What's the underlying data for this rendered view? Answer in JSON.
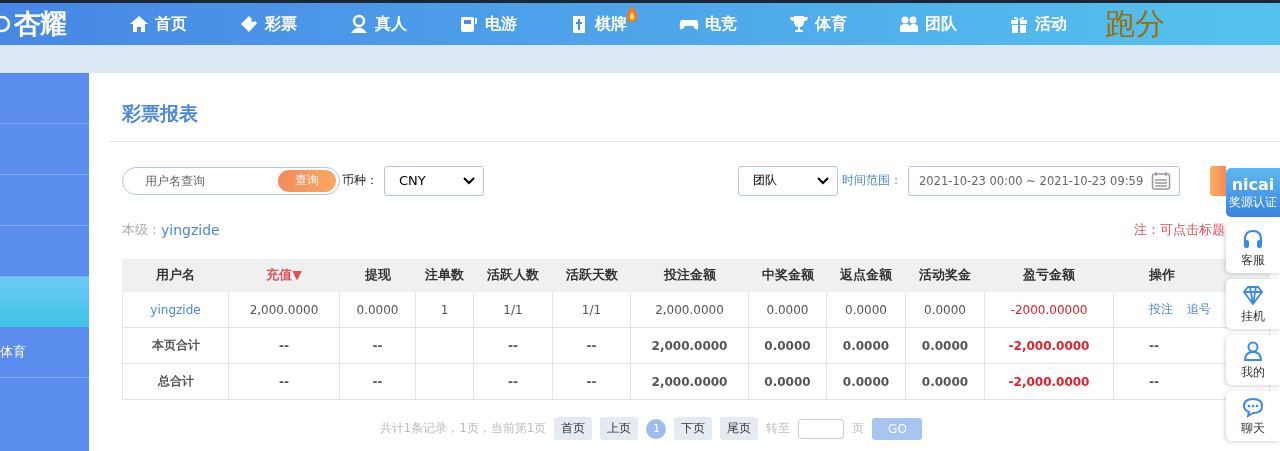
{
  "logo": {
    "text": "杏耀"
  },
  "nav": [
    {
      "label": "首页",
      "hot": false
    },
    {
      "label": "彩票",
      "hot": false
    },
    {
      "label": "真人",
      "hot": false
    },
    {
      "label": "电游",
      "hot": false
    },
    {
      "label": "棋牌",
      "hot": true
    },
    {
      "label": "电竞",
      "hot": false
    },
    {
      "label": "体育",
      "hot": false
    },
    {
      "label": "团队",
      "hot": false
    },
    {
      "label": "活动",
      "hot": false
    }
  ],
  "nav_brand": "跑分",
  "sidebar": {
    "items": [
      {
        "selected": false
      },
      {
        "selected": false
      },
      {
        "selected": false
      },
      {
        "selected": false
      },
      {
        "selected": true
      },
      {
        "label": "体育",
        "selected": false
      }
    ]
  },
  "page_title": "彩票报表",
  "filters": {
    "search": {
      "placeholder": "用户名查询",
      "button": "查询"
    },
    "currency_label": "币种：",
    "currency": "CNY",
    "scope": "团队",
    "time_label": "时间范围：",
    "time_range": "2021-10-23 00:00 ~ 2021-10-23 09:59"
  },
  "level": {
    "label": "本级：",
    "user": "yingzide"
  },
  "note": "注：可点击标题",
  "table": {
    "columns": [
      {
        "label": "用户名",
        "kind": "name",
        "sorted": false
      },
      {
        "label": "充值▼",
        "kind": "number",
        "sorted": true
      },
      {
        "label": "提现",
        "kind": "number",
        "sorted": false
      },
      {
        "label": "注单数",
        "kind": "number",
        "sorted": false
      },
      {
        "label": "活跃人数",
        "kind": "number",
        "sorted": false
      },
      {
        "label": "活跃天数",
        "kind": "number",
        "sorted": false
      },
      {
        "label": "投注金额",
        "kind": "number",
        "sorted": false
      },
      {
        "label": "中奖金额",
        "kind": "number",
        "sorted": false
      },
      {
        "label": "返点金额",
        "kind": "number",
        "sorted": false
      },
      {
        "label": "活动奖金",
        "kind": "number",
        "sorted": false
      },
      {
        "label": "盈亏金额",
        "kind": "loss",
        "sorted": false
      },
      {
        "label": "操作",
        "kind": "actions",
        "sorted": false
      }
    ],
    "rows": [
      {
        "kind": "data",
        "cells": [
          "yingzide",
          "2,000.0000",
          "0.0000",
          "1",
          "1/1",
          "1/1",
          "2,000.0000",
          "0.0000",
          "0.0000",
          "0.0000",
          "-2000.00000"
        ],
        "actions": [
          "投注",
          "追号"
        ]
      },
      {
        "kind": "total",
        "cells": [
          "本页合计",
          "--",
          "--",
          "",
          "--",
          "--",
          "2,000.0000",
          "0.0000",
          "0.0000",
          "0.0000",
          "-2,000.0000",
          "--"
        ]
      },
      {
        "kind": "total",
        "cells": [
          "总合计",
          "--",
          "--",
          "",
          "--",
          "--",
          "2,000.0000",
          "0.0000",
          "0.0000",
          "0.0000",
          "-2,000.0000",
          "--"
        ]
      }
    ]
  },
  "pagination": {
    "summary": "共计1条记录，1页，当前第1页",
    "buttons": [
      "首页",
      "上页"
    ],
    "pages": [
      {
        "label": "1",
        "selected": true
      }
    ],
    "buttons_after": [
      "下页",
      "尾页"
    ],
    "goto_label": "转至",
    "page_unit": "页",
    "go": "GO"
  },
  "float_panel": [
    {
      "kind": "badge",
      "title": "nicai",
      "label": "奖源认证"
    },
    {
      "kind": "item",
      "label": "客服"
    },
    {
      "kind": "item",
      "label": "挂机"
    },
    {
      "kind": "item",
      "label": "我的"
    },
    {
      "kind": "item",
      "label": "聊天"
    }
  ]
}
